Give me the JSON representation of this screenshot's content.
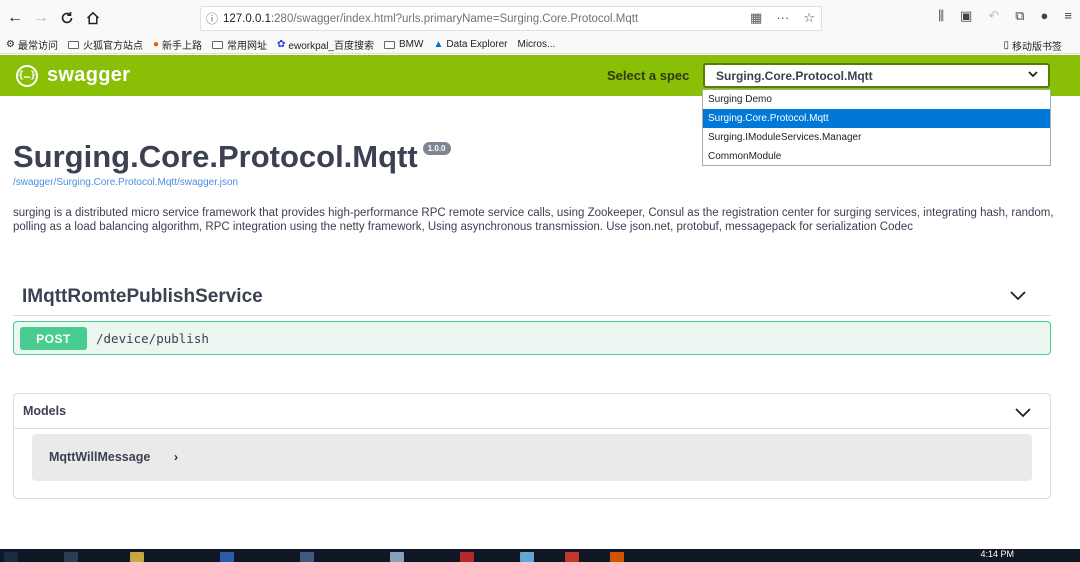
{
  "browser": {
    "url_host": "127.0.0.1",
    "url_path": ":280/swagger/index.html?urls.primaryName=Surging.Core.Protocol.Mqtt",
    "bookmarks": [
      {
        "label": "最常访问",
        "icon": "gear-icon"
      },
      {
        "label": "火狐官方站点",
        "icon": "folder-icon"
      },
      {
        "label": "新手上路",
        "icon": "firefox-icon"
      },
      {
        "label": "常用网址",
        "icon": "folder-icon"
      },
      {
        "label": "eworkpal_百度搜索",
        "icon": "baidu-icon"
      },
      {
        "label": "BMW",
        "icon": "folder-icon"
      },
      {
        "label": "Data Explorer",
        "icon": "azure-icon"
      },
      {
        "label": "Micros...",
        "icon": "none"
      }
    ],
    "mobile_bookmarks": "移动版书签"
  },
  "topbar": {
    "logo_text": "swagger",
    "spec_label": "Select a spec",
    "selected_spec": "Surging.Core.Protocol.Mqtt",
    "spec_options": [
      "Surging Demo",
      "Surging.Core.Protocol.Mqtt",
      "Surging.IModuleServices.Manager",
      "CommonModule"
    ],
    "selected_index": 1
  },
  "info": {
    "title": "Surging.Core.Protocol.Mqtt",
    "version": "1.0.0",
    "spec_url": "/swagger/Surging.Core.Protocol.Mqtt/swagger.json",
    "description": "surging is a distributed micro service framework that provides high-performance RPC remote service calls, using Zookeeper, Consul as the registration center for surging services, integrating hash, random, polling as a load balancing algorithm, RPC integration using the netty framework, Using asynchronous transmission. Use json.net, protobuf, messagepack for serialization Codec"
  },
  "operations": {
    "tag": "IMqttRomtePublishService",
    "items": [
      {
        "method": "POST",
        "path": "/device/publish"
      }
    ]
  },
  "models": {
    "title": "Models",
    "items": [
      "MqttWillMessage"
    ]
  },
  "taskbar": {
    "time": "4:14 PM"
  },
  "colors": {
    "topbar": "#89bf04",
    "post": "#49cc90",
    "post_bg": "#ecf6f0",
    "selected_option": "#0078d7"
  }
}
